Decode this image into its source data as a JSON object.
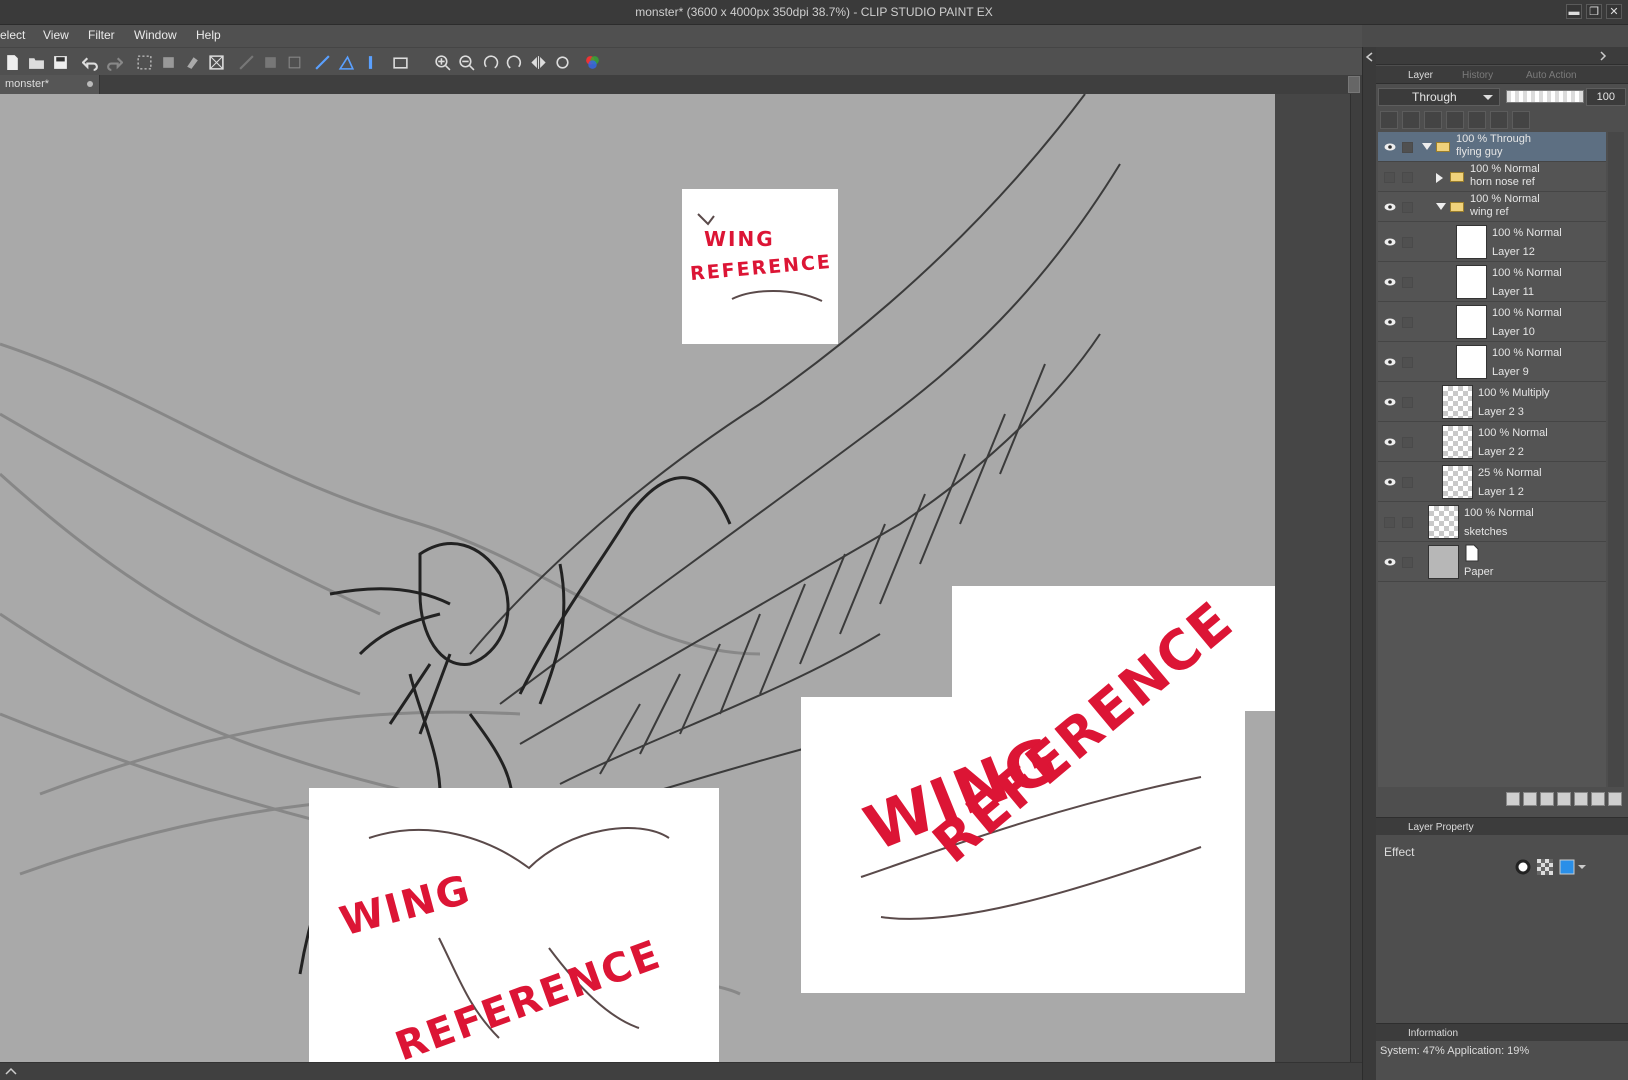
{
  "window": {
    "title": "monster* (3600 x 4000px 350dpi 38.7%)  - CLIP STUDIO PAINT EX",
    "buttons": [
      "▬",
      "❐",
      "✕"
    ]
  },
  "menu": [
    "elect",
    "View",
    "Filter",
    "Window",
    "Help"
  ],
  "toolbar": {
    "icons": [
      "new-file-icon",
      "open-file-icon",
      "save-icon",
      "undo-icon",
      "redo-icon",
      "select-all-icon",
      "deselect-icon",
      "clear-icon",
      "transform-icon",
      "crop-icon",
      "fill-icon",
      "select-tool-icon",
      "ruler-icon",
      "perspective-icon",
      "snap-icon",
      "frame-icon",
      "zoom-in-icon",
      "zoom-out-icon",
      "rotate-left-icon",
      "rotate-right-icon",
      "flip-icon",
      "reset-rotation-icon",
      "color-icon"
    ]
  },
  "document_tab": {
    "label": "monster*"
  },
  "canvas": {
    "references": [
      {
        "text_line1": "WING",
        "text_line2": "REFERENCE"
      },
      {
        "text_line1": "WING",
        "text_line2": "REFERENCE"
      },
      {
        "text_line1": "WING",
        "text_line2": "REFERENCE"
      }
    ]
  },
  "layer_panel": {
    "tabs": [
      {
        "label": "Layer",
        "icon": "layer-icon",
        "active": true
      },
      {
        "label": "History",
        "icon": "history-icon",
        "active": false
      },
      {
        "label": "Auto Action",
        "icon": "auto-action-icon",
        "active": false
      }
    ],
    "blend_mode": "Through",
    "opacity": "100",
    "layers": [
      {
        "mode": "100 % Through",
        "name": "flying guy",
        "type": "folder",
        "selected": true,
        "expanded": true,
        "visible": true,
        "indent": 0
      },
      {
        "mode": "100 % Normal",
        "name": "horn nose ref",
        "type": "folder",
        "selected": false,
        "expanded": false,
        "visible": false,
        "indent": 1
      },
      {
        "mode": "100 % Normal",
        "name": "wing ref",
        "type": "folder",
        "selected": false,
        "expanded": true,
        "visible": true,
        "indent": 1
      },
      {
        "mode": "100 % Normal",
        "name": "Layer 12",
        "type": "layer",
        "thumb": "white",
        "visible": true,
        "indent": 2
      },
      {
        "mode": "100 % Normal",
        "name": "Layer 11",
        "type": "layer",
        "thumb": "white",
        "visible": true,
        "indent": 2
      },
      {
        "mode": "100 % Normal",
        "name": "Layer 10",
        "type": "layer",
        "thumb": "white",
        "visible": true,
        "indent": 2
      },
      {
        "mode": "100 % Normal",
        "name": "Layer 9",
        "type": "layer",
        "thumb": "white",
        "visible": true,
        "indent": 2
      },
      {
        "mode": "100 % Multiply",
        "name": "Layer 2 3",
        "type": "layer",
        "thumb": "check",
        "visible": true,
        "indent": 1
      },
      {
        "mode": "100 % Normal",
        "name": "Layer 2 2",
        "type": "layer",
        "thumb": "check",
        "visible": true,
        "indent": 1
      },
      {
        "mode": "25 % Normal",
        "name": "Layer 1 2",
        "type": "layer",
        "thumb": "check",
        "visible": true,
        "indent": 1
      },
      {
        "mode": "100 % Normal",
        "name": "sketches",
        "type": "layer",
        "thumb": "check",
        "visible": false,
        "indent": 0
      },
      {
        "mode": "",
        "name": "Paper",
        "type": "paper",
        "thumb": "gray",
        "visible": true,
        "indent": 0
      }
    ]
  },
  "property_panel": {
    "tabs": [
      {
        "label": "Layer Property",
        "icon": "layer-property-icon"
      }
    ],
    "effect_label": "Effect"
  },
  "info_panel": {
    "tab_label": "Information",
    "status": "System: 47% Application: 19%"
  }
}
